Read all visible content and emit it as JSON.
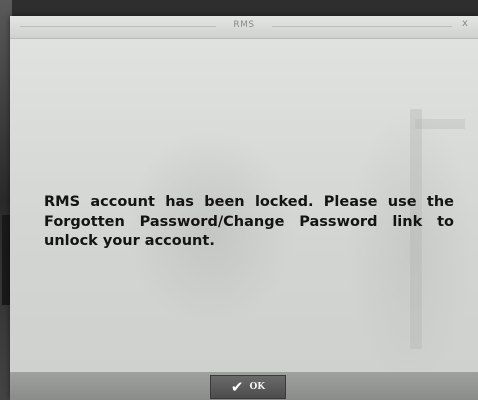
{
  "window": {
    "title": "RMS",
    "close_glyph": "x"
  },
  "dialog": {
    "message": "RMS account has been locked. Please use the Forgotten Password/Change Password link to unlock your account."
  },
  "footer": {
    "ok_label": "OK",
    "ok_icon": "check-icon",
    "ok_glyph": "✔"
  }
}
